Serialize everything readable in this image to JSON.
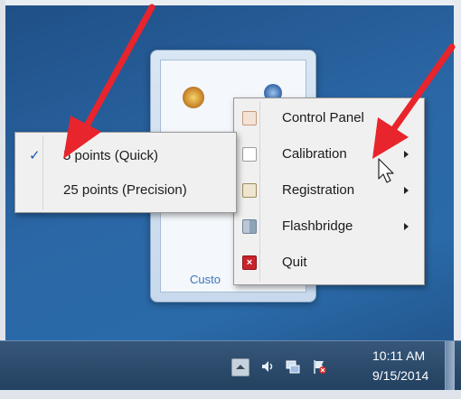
{
  "flyout": {
    "customize_label": "Custo"
  },
  "context_menu": {
    "items": [
      {
        "label": "Control Panel",
        "icon": "control-panel-icon",
        "has_submenu": false
      },
      {
        "label": "Calibration",
        "icon": "calibration-icon",
        "has_submenu": true
      },
      {
        "label": "Registration",
        "icon": "registration-icon",
        "has_submenu": true
      },
      {
        "label": "Flashbridge",
        "icon": "flashbridge-icon",
        "has_submenu": true
      },
      {
        "label": "Quit",
        "icon": "quit-icon",
        "has_submenu": false
      }
    ]
  },
  "calibration_submenu": {
    "items": [
      {
        "label": "5 points (Quick)",
        "checked": true
      },
      {
        "label": "25 points (Precision)",
        "checked": false
      }
    ]
  },
  "taskbar": {
    "time": "10:11 AM",
    "date": "9/15/2014"
  },
  "colors": {
    "annotation_arrow": "#e8242c",
    "desktop": "#2a67a6",
    "check_mark": "#1d55a8"
  }
}
